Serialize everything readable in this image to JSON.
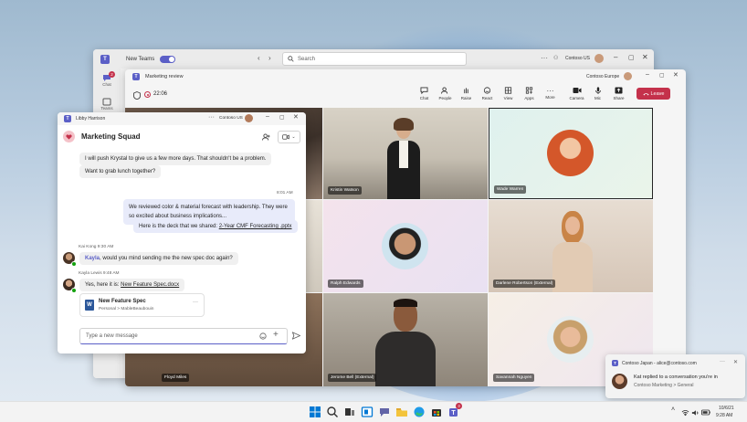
{
  "main_window": {
    "app_label": "New Teams",
    "search_placeholder": "Search",
    "account": "Contoso US",
    "rail": [
      {
        "label": "Chat",
        "badge": "2"
      },
      {
        "label": "Teams"
      }
    ]
  },
  "meeting": {
    "title": "Marketing review",
    "account": "Contoso Europe",
    "timer": "22:06",
    "toolbar": [
      {
        "label": "Chat",
        "icon": "chat-icon"
      },
      {
        "label": "People",
        "icon": "people-icon"
      },
      {
        "label": "Raise",
        "icon": "raise-hand-icon"
      },
      {
        "label": "React",
        "icon": "react-icon"
      },
      {
        "label": "View",
        "icon": "view-icon"
      },
      {
        "label": "Apps",
        "icon": "apps-icon"
      },
      {
        "label": "More",
        "icon": "more-icon"
      },
      {
        "label": "Camera",
        "icon": "camera-icon"
      },
      {
        "label": "Mic",
        "icon": "mic-icon"
      },
      {
        "label": "Share",
        "icon": "share-icon"
      }
    ],
    "leave_label": "Leave",
    "participants": [
      {
        "name": "Kristin Watson"
      },
      {
        "name": "Wade Warren"
      },
      {
        "name": "Ralph Edwards"
      },
      {
        "name": "Darlene Robertson (External)"
      },
      {
        "name": "Floyd Miles"
      },
      {
        "name": "Jerome Bell (External)"
      },
      {
        "name": "Savannah Nguyen"
      }
    ]
  },
  "chat": {
    "window_user": "Libby Harrison",
    "account": "Contoso US",
    "title": "Marketing Squad",
    "messages": {
      "m1": "I will push Krystal to give us a few more days. That shouldn't be a problem.",
      "m2": "Want to grab lunch together?",
      "time_me": "8:01 AM",
      "m3_line1": "We reviewed color & material forecast with leadership. They were",
      "m3_line2": "so excited about business implications...",
      "m4_prefix": "Here is the deck that we shared:",
      "m4_link": "2-Year CMF Forecasting .pptx",
      "kai_meta": "Kai Kong  9:30 AM",
      "kai_mention": "Kayla",
      "kai_text": ", would you mind sending me the new spec doc again?",
      "kayla_meta": "Kayla Lewis  9:48 AM",
      "kayla_prefix": "Yes, here it is:",
      "kayla_link": "New Feature Spec.docx",
      "file_name": "New Feature Spec",
      "file_path": "Personal > MableBeaubouin"
    },
    "compose_placeholder": "Type a new message"
  },
  "toast": {
    "account": "Contoso Japan - alice@contoso.com",
    "title": "Kat replied to a conversation you're in",
    "subtitle": "Contoso Marketing > General"
  },
  "taskbar": {
    "date": "10/6/21",
    "time": "9:28 AM",
    "teams_badge": "3"
  }
}
